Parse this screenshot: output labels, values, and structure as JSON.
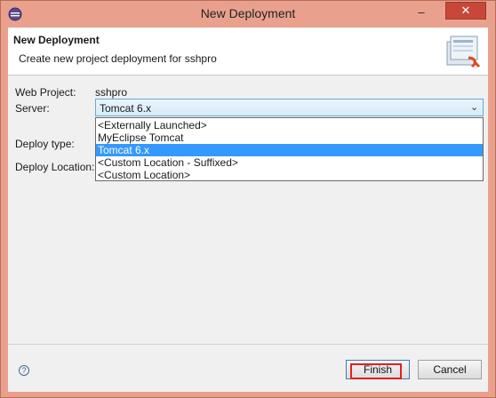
{
  "window": {
    "title": "New Deployment",
    "minimize_glyph": "–",
    "close_glyph": "✕"
  },
  "header": {
    "title": "New Deployment",
    "description": "Create new project deployment for sshpro",
    "graphic_icon": "deployment-wizard-icon"
  },
  "form": {
    "web_project_label": "Web Project:",
    "web_project_value": "sshpro",
    "server_label": "Server:",
    "server_value": "Tomcat  6.x",
    "server_arrow": "⌄",
    "deploy_type_label": "Deploy type:",
    "deploy_location_label": "Deploy Location:"
  },
  "server_options": [
    {
      "label": "<Externally Launched>",
      "selected": false
    },
    {
      "label": "MyEclipse Tomcat",
      "selected": false
    },
    {
      "label": "Tomcat  6.x",
      "selected": true
    },
    {
      "label": "<Custom Location - Suffixed>",
      "selected": false
    },
    {
      "label": "<Custom Location>",
      "selected": false
    }
  ],
  "footer": {
    "help_glyph": "?",
    "finish_label": "Finish",
    "cancel_label": "Cancel"
  },
  "colors": {
    "titlebar": "#e9a18e",
    "close_button": "#c7473a",
    "selection": "#3399ff",
    "highlight_box": "#e02020"
  }
}
